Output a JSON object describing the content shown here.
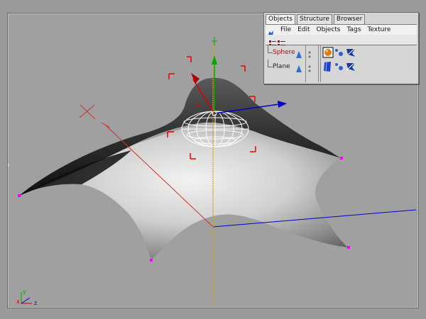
{
  "object_manager": {
    "tabs": [
      {
        "label": "Objects"
      },
      {
        "label": "Structure"
      },
      {
        "label": "Browser"
      }
    ],
    "menu": [
      {
        "label": "File"
      },
      {
        "label": "Edit"
      },
      {
        "label": "Objects"
      },
      {
        "label": "Tags"
      },
      {
        "label": "Texture"
      }
    ],
    "objects": [
      {
        "name": "Sphere",
        "selected": true
      },
      {
        "name": "Plane",
        "selected": false
      }
    ]
  },
  "viewport": {
    "edge_marker": "‹",
    "axis_indicator": {
      "x": "x",
      "y": "y",
      "z": "z"
    }
  },
  "colors": {
    "selected_object": "#c00000",
    "x_axis": "#cc0000",
    "y_axis": "#00aa00",
    "z_axis": "#0000cc",
    "handles": "#ff00ff"
  }
}
